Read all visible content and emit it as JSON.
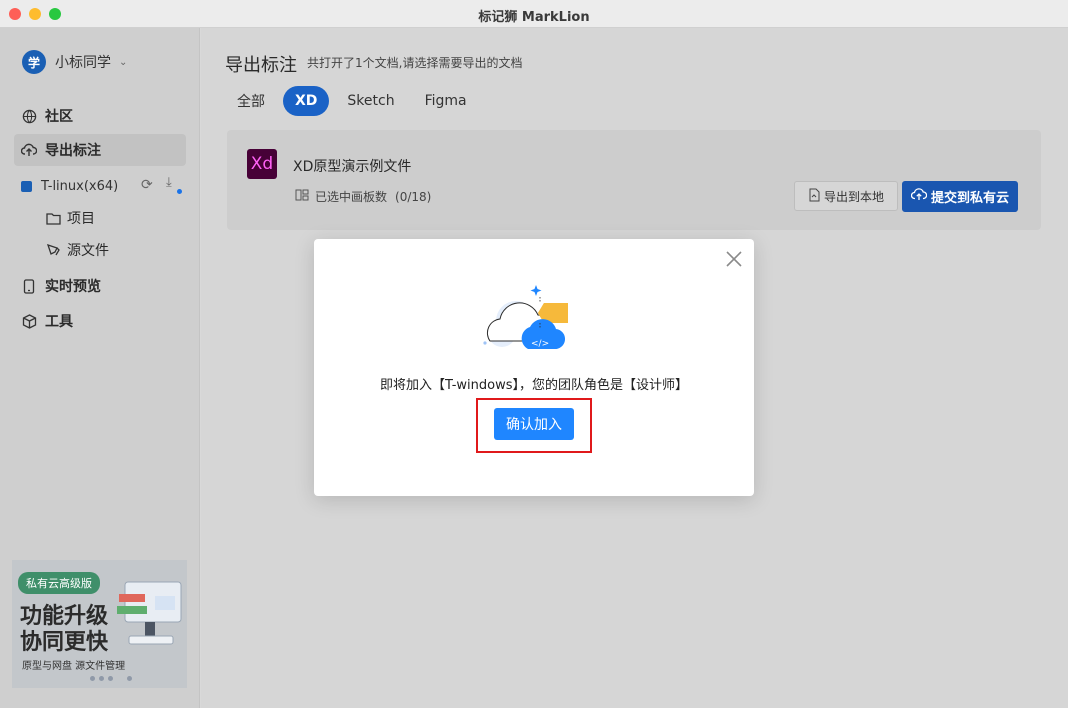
{
  "window": {
    "title": "标记狮 MarkLion"
  },
  "user": {
    "avatar_text": "学",
    "name": "小标同学"
  },
  "nav": {
    "community": "社区",
    "export": "导出标注",
    "realtime": "实时预览",
    "tools": "工具"
  },
  "team": {
    "name": "T-linux(x64)"
  },
  "sub": {
    "project": "项目",
    "source": "源文件"
  },
  "promo": {
    "badge": "私有云高级版",
    "head1": "功能升级",
    "head2": "协同更快",
    "sub": "原型与网盘   源文件管理"
  },
  "main": {
    "title": "导出标注",
    "subtitle": "共打开了1个文档,请选择需要导出的文档",
    "tabs": [
      "全部",
      "XD",
      "Sketch",
      "Figma"
    ],
    "active_tab": "XD"
  },
  "file": {
    "logo": "Xd",
    "name": "XD原型演示例文件",
    "selected_label": "已选中画板数",
    "selected_count": "(0/18)",
    "export_local": "导出到本地",
    "submit_cloud": "提交到私有云"
  },
  "modal": {
    "message": "即将加入【T-windows】，您的团队角色是【设计师】",
    "confirm": "确认加入"
  },
  "colors": {
    "accent": "#1f86ff",
    "highlight": "#e0191b",
    "brand": "#1a5fb4"
  }
}
